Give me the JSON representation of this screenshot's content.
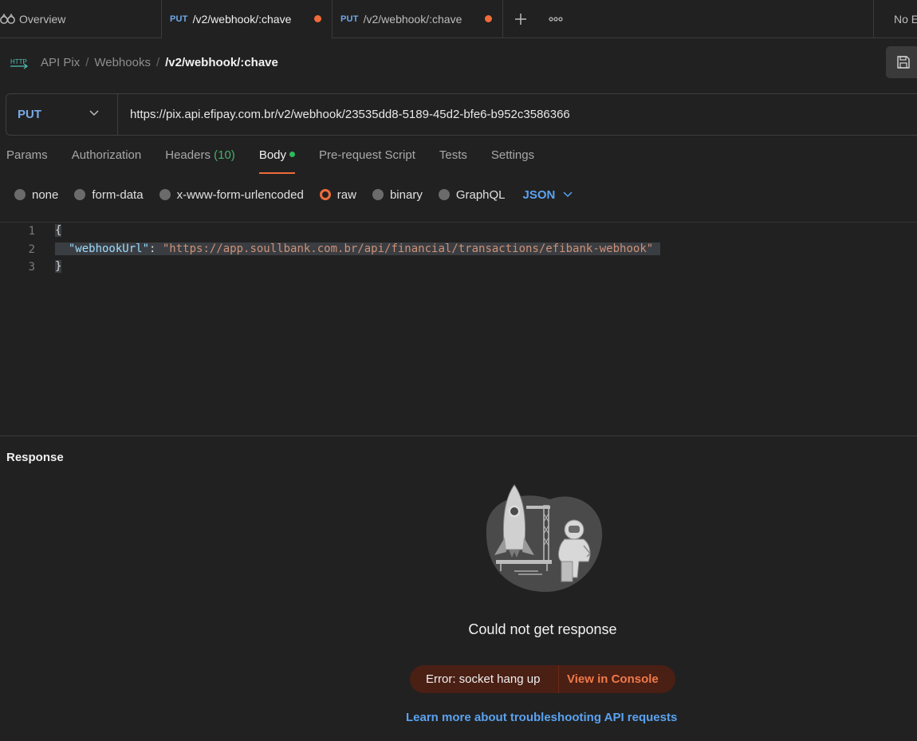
{
  "tabs": {
    "overview_label": "Overview",
    "requests": [
      {
        "method": "PUT",
        "label": "/v2/webhook/:chave"
      },
      {
        "method": "PUT",
        "label": "/v2/webhook/:chave"
      }
    ],
    "environment_label": "No E"
  },
  "breadcrumb": {
    "icon_text": "HTTP",
    "items": [
      "API Pix",
      "Webhooks"
    ],
    "current": "/v2/webhook/:chave"
  },
  "request": {
    "method": "PUT",
    "url": "https://pix.api.efipay.com.br/v2/webhook/23535dd8-5189-45d2-bfe6-b952c3586366"
  },
  "request_tabs": {
    "params": "Params",
    "authorization": "Authorization",
    "headers": "Headers",
    "headers_count": "(10)",
    "body": "Body",
    "prerequest": "Pre-request Script",
    "tests": "Tests",
    "settings": "Settings"
  },
  "body_types": {
    "none": "none",
    "form_data": "form-data",
    "urlencoded": "x-www-form-urlencoded",
    "raw": "raw",
    "binary": "binary",
    "graphql": "GraphQL",
    "language": "JSON"
  },
  "editor": {
    "line_numbers": [
      "1",
      "2",
      "3"
    ],
    "open_brace": "{",
    "key": "\"webhookUrl\"",
    "colon": ": ",
    "value": "\"https://app.soullbank.com.br/api/financial/transactions/efibank-webhook\"",
    "close_brace": "}"
  },
  "response": {
    "title": "Response",
    "message": "Could not get response",
    "error": "Error: socket hang up",
    "console_link": "View in Console",
    "learn_more": "Learn more about troubleshooting API requests"
  },
  "colors": {
    "accent": "#ef6b3a",
    "method_blue": "#6fa8e8",
    "link_blue": "#5aa2f0",
    "success_green": "#2dba5c",
    "background": "#212121"
  }
}
